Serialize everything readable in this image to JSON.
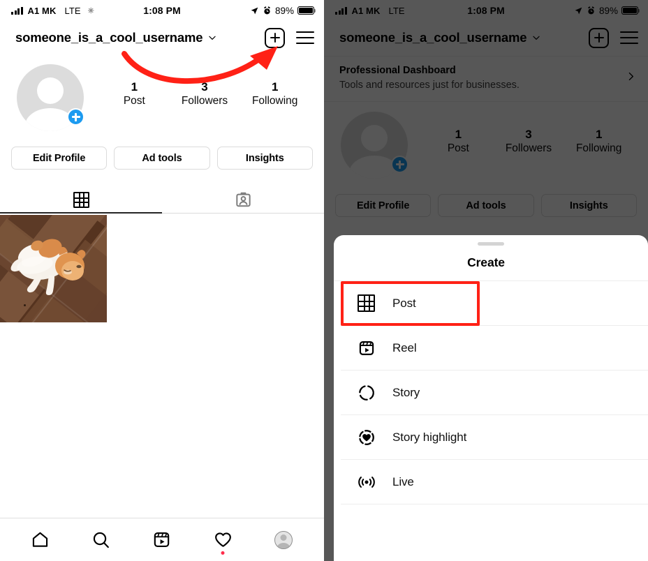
{
  "status_bar": {
    "signal_icon": "signal-bars-icon",
    "carrier": "A1 MK",
    "network": "LTE",
    "sparkle_icon": "sparkle-icon",
    "time": "1:08 PM",
    "location_icon": "location-arrow-icon",
    "alarm_icon": "alarm-clock-icon",
    "battery_percent": "89%",
    "battery_icon": "battery-full-icon"
  },
  "header": {
    "username": "someone_is_a_cool_username",
    "chevron_icon": "chevron-down-icon",
    "add_icon": "plus-square-icon",
    "menu_icon": "hamburger-menu-icon"
  },
  "profile": {
    "avatar_icon": "default-avatar-icon",
    "add_story_icon": "plus-badge-icon",
    "stats": [
      {
        "number": "1",
        "label": "Post"
      },
      {
        "number": "3",
        "label": "Followers"
      },
      {
        "number": "1",
        "label": "Following"
      }
    ],
    "buttons": [
      {
        "label": "Edit Profile"
      },
      {
        "label": "Ad tools"
      },
      {
        "label": "Insights"
      }
    ]
  },
  "professional_dashboard": {
    "title": "Professional Dashboard",
    "subtitle": "Tools and resources just for businesses.",
    "chevron_icon": "chevron-right-icon"
  },
  "tabs": [
    {
      "icon": "grid-icon",
      "active": true
    },
    {
      "icon": "tagged-person-icon",
      "active": false
    }
  ],
  "grid": {
    "posts": [
      {
        "alt": "cat-lying-on-wooden-floor"
      }
    ]
  },
  "bottom_nav": [
    {
      "icon": "home-icon",
      "badge": false
    },
    {
      "icon": "search-icon",
      "badge": false
    },
    {
      "icon": "reels-icon",
      "badge": false
    },
    {
      "icon": "heart-icon",
      "badge": true
    },
    {
      "icon": "profile-avatar-icon",
      "badge": false
    }
  ],
  "create_sheet": {
    "handle_icon": "drag-handle-icon",
    "title": "Create",
    "items": [
      {
        "icon": "grid-icon",
        "label": "Post",
        "highlighted": true
      },
      {
        "icon": "reel-icon",
        "label": "Reel",
        "highlighted": false
      },
      {
        "icon": "story-icon",
        "label": "Story",
        "highlighted": false
      },
      {
        "icon": "story-highlight-icon",
        "label": "Story highlight",
        "highlighted": false
      },
      {
        "icon": "live-icon",
        "label": "Live",
        "highlighted": false
      }
    ]
  },
  "annotations": {
    "arrow_color": "#ff2116",
    "highlight_box_color": "#ff2116",
    "arrow_target": "plus-square-icon",
    "highlight_target": "Post"
  },
  "colors": {
    "accent_blue": "#1d9bf0",
    "notification_red": "#ff2d4b",
    "annotation_red": "#ff2116",
    "text_primary": "#000000",
    "border": "#dbdbdb"
  }
}
